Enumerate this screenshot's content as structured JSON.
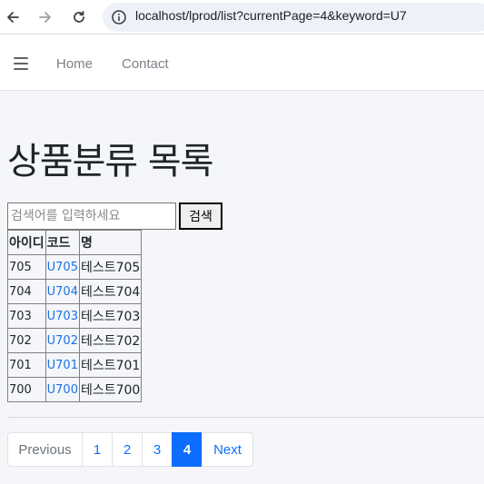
{
  "browser": {
    "url": "localhost/lprod/list?currentPage=4&keyword=U7"
  },
  "navbar": {
    "links": [
      "Home",
      "Contact"
    ]
  },
  "main": {
    "title": "상품분류 목록",
    "search": {
      "placeholder": "검색어를 입력하세요",
      "value": "",
      "button_label": "검색"
    },
    "table": {
      "headers": [
        "아이디",
        "코드",
        "명"
      ],
      "rows": [
        {
          "id": "705",
          "code": "U705",
          "name": "테스트705"
        },
        {
          "id": "704",
          "code": "U704",
          "name": "테스트704"
        },
        {
          "id": "703",
          "code": "U703",
          "name": "테스트703"
        },
        {
          "id": "702",
          "code": "U702",
          "name": "테스트702"
        },
        {
          "id": "701",
          "code": "U701",
          "name": "테스트701"
        },
        {
          "id": "700",
          "code": "U700",
          "name": "테스트700"
        }
      ]
    },
    "pagination": {
      "previous": "Previous",
      "pages": [
        "1",
        "2",
        "3",
        "4"
      ],
      "active_page": "4",
      "next": "Next"
    }
  },
  "colors": {
    "link": "#1a73e8",
    "active_page": "#0d6efd",
    "background": "#f5f6f9"
  }
}
